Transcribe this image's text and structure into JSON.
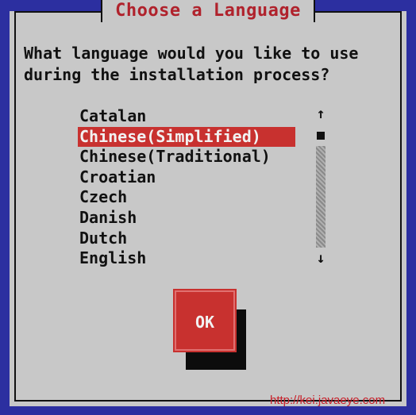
{
  "dialog": {
    "title": "Choose a Language",
    "prompt_line1": "What language would you like to use",
    "prompt_line2": "during the installation process?"
  },
  "language_list": {
    "items": [
      "Catalan",
      "Chinese(Simplified)",
      "Chinese(Traditional)",
      "Croatian",
      "Czech",
      "Danish",
      "Dutch",
      "English"
    ],
    "selected": "Chinese(Simplified)"
  },
  "scrollbar": {
    "up_arrow": "↑",
    "down_arrow": "↓"
  },
  "buttons": {
    "ok_label": "OK"
  },
  "watermark": "http://kei.javaeye.com",
  "colors": {
    "background": "#2c2fa0",
    "dialog": "#c8c8c8",
    "accent": "#c8312f",
    "title_text": "#b0222c"
  }
}
